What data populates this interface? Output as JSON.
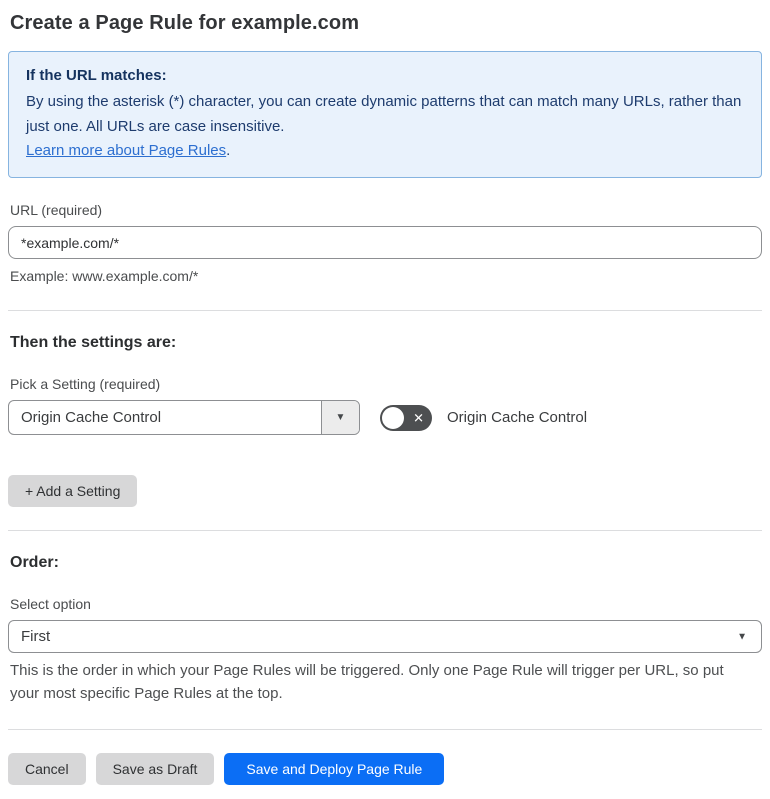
{
  "page": {
    "title": "Create a Page Rule for example.com"
  },
  "info_box": {
    "heading": "If the URL matches:",
    "body": "By using the asterisk (*) character, you can create dynamic patterns that can match many URLs, rather than just one. All URLs are case insensitive.",
    "link_label": "Learn more about Page Rules",
    "link_suffix": "."
  },
  "url_field": {
    "label": "URL (required)",
    "value": "*example.com/*",
    "helper": "Example: www.example.com/*"
  },
  "settings_section": {
    "heading": "Then the settings are:",
    "picker_label": "Pick a Setting (required)",
    "picker_value": "Origin Cache Control",
    "toggle_state": "off",
    "toggle_label": "Origin Cache Control",
    "add_setting_label": "+ Add a Setting"
  },
  "order_section": {
    "heading": "Order:",
    "select_label": "Select option",
    "select_value": "First",
    "helper": "This is the order in which your Page Rules will be triggered. Only one Page Rule will trigger per URL, so put your most specific Page Rules at the top."
  },
  "footer": {
    "cancel_label": "Cancel",
    "save_draft_label": "Save as Draft",
    "save_deploy_label": "Save and Deploy Page Rule"
  },
  "icons": {
    "caret_down": "▼",
    "toggle_x": "✕"
  },
  "colors": {
    "info_bg": "#e9f2fc",
    "info_border": "#86b4e0",
    "info_text": "#1e3c6e",
    "link_blue": "#2d6fd0",
    "primary_blue": "#0b6ef5",
    "toggle_off_bg": "#4d4f51",
    "gray_button_bg": "#d7d7d8"
  }
}
